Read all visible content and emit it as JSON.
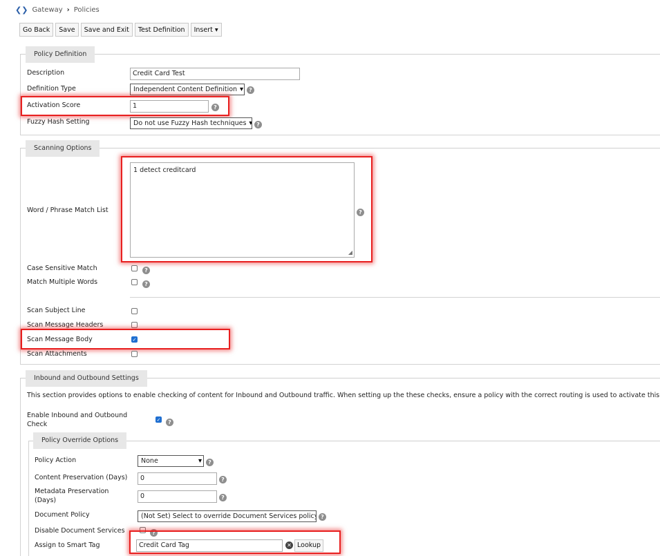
{
  "breadcrumb": {
    "items": [
      "Gateway",
      "Policies"
    ]
  },
  "toolbar": {
    "go_back": "Go Back",
    "save": "Save",
    "save_exit": "Save and Exit",
    "test_definition": "Test Definition",
    "insert": "Insert"
  },
  "policy_definition": {
    "legend": "Policy Definition",
    "description_label": "Description",
    "description_value": "Credit Card Test",
    "definition_type_label": "Definition Type",
    "definition_type_value": "Independent Content Definition",
    "activation_score_label": "Activation Score",
    "activation_score_value": "1",
    "fuzzy_hash_label": "Fuzzy Hash Setting",
    "fuzzy_hash_value": "Do not use Fuzzy Hash techniques"
  },
  "scanning_options": {
    "legend": "Scanning Options",
    "word_list_label": "Word / Phrase Match List",
    "word_list_value": "1 detect creditcard",
    "case_sensitive_label": "Case Sensitive Match",
    "match_multiple_label": "Match Multiple Words",
    "scan_subject_label": "Scan Subject Line",
    "scan_headers_label": "Scan Message Headers",
    "scan_body_label": "Scan Message Body",
    "scan_attachments_label": "Scan Attachments"
  },
  "inbound_outbound": {
    "legend": "Inbound and Outbound Settings",
    "description": "This section provides options to enable checking of content for Inbound and Outbound traffic. When setting up the these checks, ensure a policy with the correct routing is used to activate this definiti",
    "enable_label_line1": "Enable Inbound and Outbound",
    "enable_label_line2": "Check"
  },
  "policy_override": {
    "legend": "Policy Override Options",
    "policy_action_label": "Policy Action",
    "policy_action_value": "None",
    "content_preservation_label": "Content Preservation (Days)",
    "content_preservation_value": "0",
    "metadata_preservation_label_line1": "Metadata Preservation",
    "metadata_preservation_label_line2": "(Days)",
    "metadata_preservation_value": "0",
    "document_policy_label": "Document Policy",
    "document_policy_value": "(Not Set) Select to override Document Services policy",
    "disable_doc_services_label": "Disable Document Services",
    "smart_tag_label": "Assign to Smart Tag",
    "smart_tag_value": "Credit Card Tag",
    "lookup_label": "Lookup"
  },
  "icons": {
    "help": "?",
    "checkmark": "✓",
    "chevron": "▾",
    "clear": "✕",
    "breadcrumb_sep": "›",
    "logo": "❮❯"
  },
  "colors": {
    "highlight": "#e81f1f",
    "checkbox_on": "#1f6fd1"
  }
}
